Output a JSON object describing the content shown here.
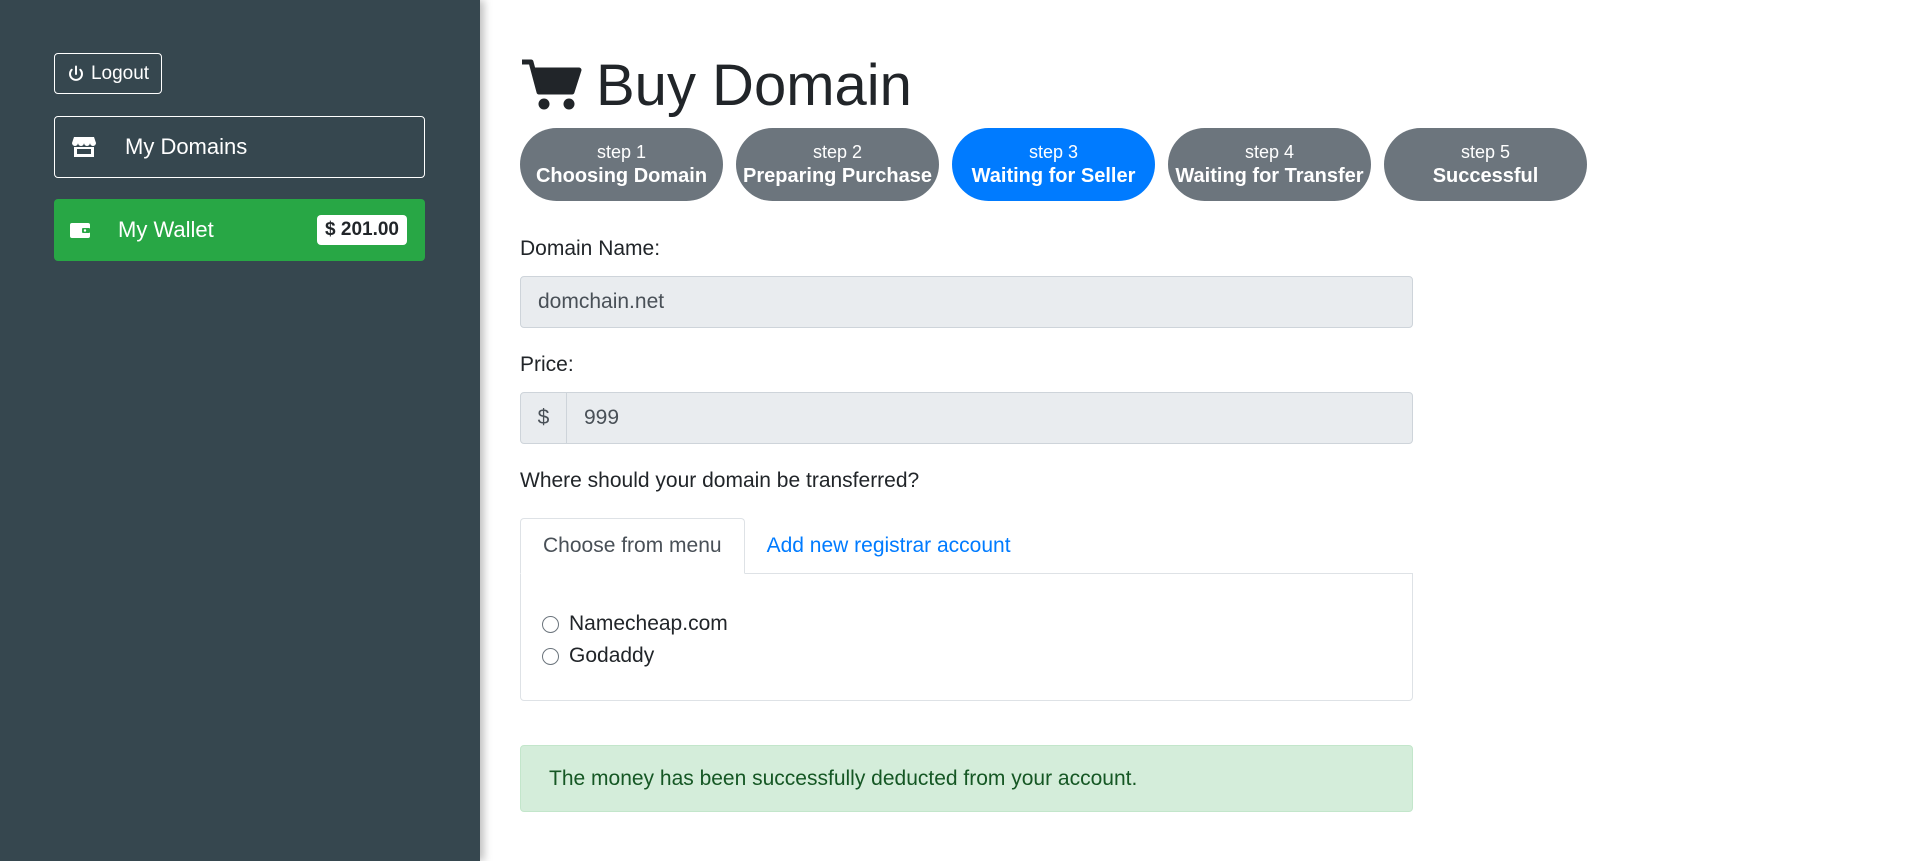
{
  "sidebar": {
    "logout_label": "Logout",
    "my_domains_label": "My Domains",
    "my_wallet_label": "My Wallet",
    "wallet_balance": "$ 201.00"
  },
  "page": {
    "title": "Buy Domain"
  },
  "steps": [
    {
      "num": "step 1",
      "name": "Choosing Domain",
      "active": false
    },
    {
      "num": "step 2",
      "name": "Preparing Purchase",
      "active": false
    },
    {
      "num": "step 3",
      "name": "Waiting for Seller",
      "active": true
    },
    {
      "num": "step 4",
      "name": "Waiting for Transfer",
      "active": false
    },
    {
      "num": "step 5",
      "name": "Successful",
      "active": false
    }
  ],
  "form": {
    "domain_label": "Domain Name:",
    "domain_value": "domchain.net",
    "price_label": "Price:",
    "price_prefix": "$",
    "price_value": "999",
    "transfer_question": "Where should your domain be transferred?"
  },
  "tabs": {
    "choose_label": "Choose from menu",
    "add_label": "Add new registrar account",
    "options": [
      "Namecheap.com",
      "Godaddy"
    ]
  },
  "alert": {
    "message": "The money has been successfully deducted from your account."
  },
  "colors": {
    "sidebar_bg": "#36474f",
    "wallet_green": "#28a745",
    "step_active": "#007bff",
    "step_inactive": "#6c757d",
    "alert_bg": "#d4edda",
    "alert_text": "#155724"
  }
}
